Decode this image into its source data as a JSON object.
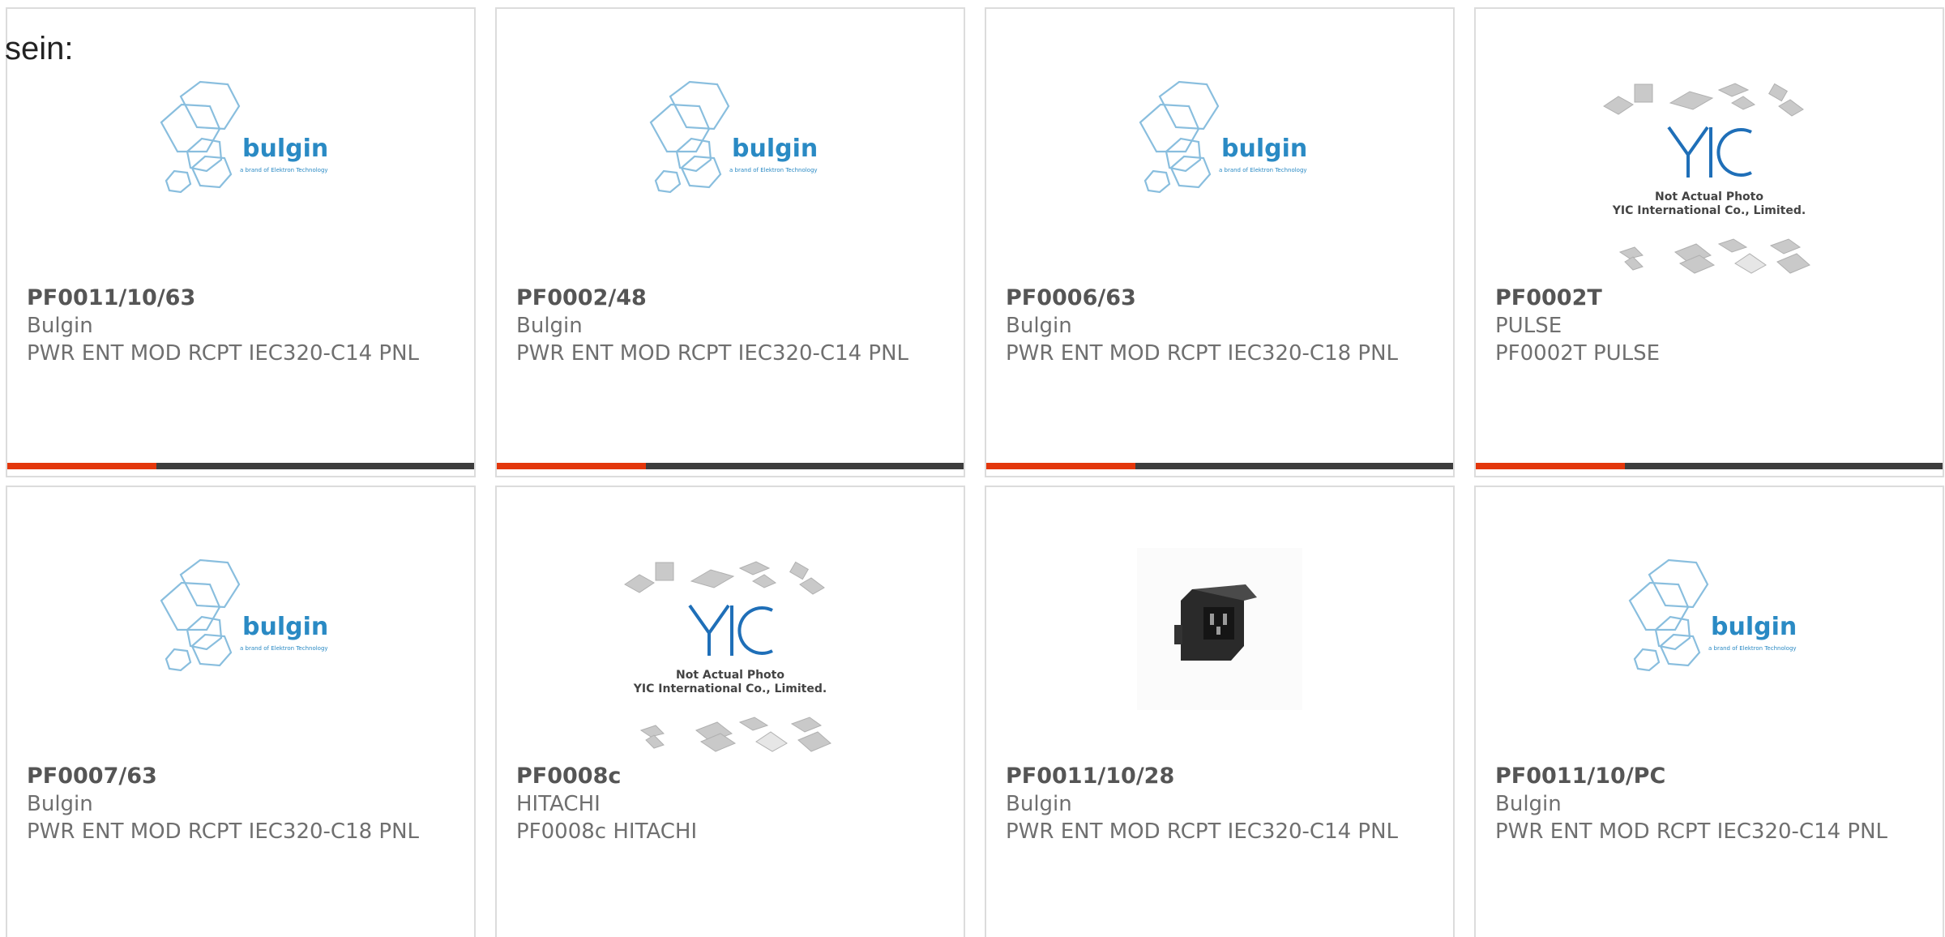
{
  "lead_text": "sein:",
  "brand_logos": {
    "bulgin": {
      "name": "bulgin",
      "tagline": "a brand of Elektron Technology",
      "color": "#2a8ac4"
    },
    "yic": {
      "mark": "YIC",
      "line1": "Not Actual Photo",
      "line2": "YIC International Co., Limited."
    }
  },
  "products": [
    {
      "part": "PF0011/10/63",
      "manufacturer": "Bulgin",
      "description": "PWR ENT MOD RCPT IEC320-C14 PNL",
      "image": "bulgin-logo",
      "progress": 0.32
    },
    {
      "part": "PF0002/48",
      "manufacturer": "Bulgin",
      "description": "PWR ENT MOD RCPT IEC320-C14 PNL",
      "image": "bulgin-logo",
      "progress": 0.32
    },
    {
      "part": "PF0006/63",
      "manufacturer": "Bulgin",
      "description": "PWR ENT MOD RCPT IEC320-C18 PNL",
      "image": "bulgin-logo",
      "progress": 0.32
    },
    {
      "part": "PF0002T",
      "manufacturer": "PULSE",
      "description": "PF0002T PULSE",
      "image": "yic-placeholder",
      "progress": 0.32
    },
    {
      "part": "PF0007/63",
      "manufacturer": "Bulgin",
      "description": "PWR ENT MOD RCPT IEC320-C18 PNL",
      "image": "bulgin-logo"
    },
    {
      "part": "PF0008c",
      "manufacturer": "HITACHI",
      "description": "PF0008c HITACHI",
      "image": "yic-placeholder"
    },
    {
      "part": "PF0011/10/28",
      "manufacturer": "Bulgin",
      "description": "PWR ENT MOD RCPT IEC320-C14 PNL",
      "image": "connector-photo"
    },
    {
      "part": "PF0011/10/PC",
      "manufacturer": "Bulgin",
      "description": "PWR ENT MOD RCPT IEC320-C14 PNL",
      "image": "bulgin-logo"
    }
  ],
  "colors": {
    "accent": "#e3370c",
    "bar": "#3d3d3d",
    "border": "#dcdcdc"
  }
}
